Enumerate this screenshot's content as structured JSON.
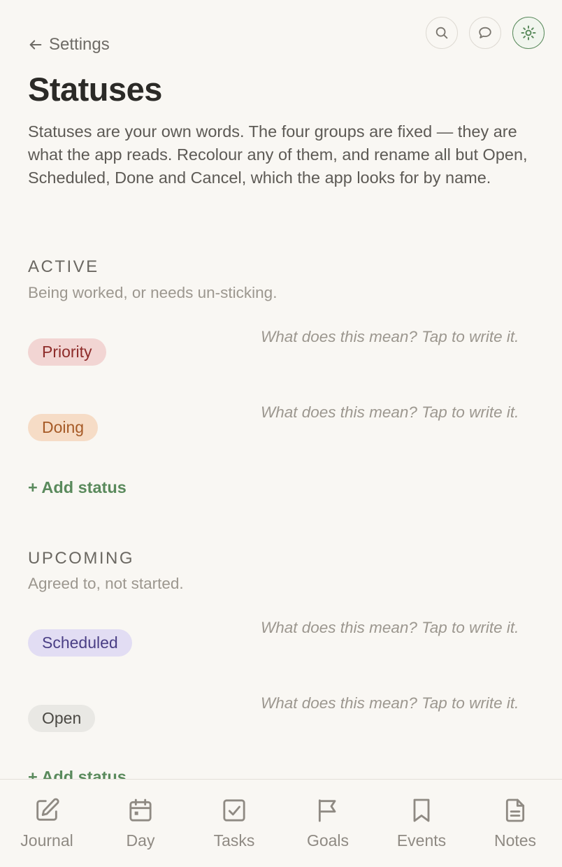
{
  "header": {
    "back_label": "Settings",
    "title": "Statuses",
    "intro": "Statuses are your own words. The four groups are fixed — they are what the app reads. Recolour any of them, and rename all but Open, Scheduled, Done and Cancel, which the app looks for by name."
  },
  "top_icons": [
    {
      "name": "search-icon"
    },
    {
      "name": "chat-bubble-icon"
    },
    {
      "name": "sun-icon",
      "active": true
    }
  ],
  "colors": {
    "accent_green": "#5a8a5c",
    "priority_bg": "#f2d5d3",
    "priority_fg": "#8e2c2a",
    "doing_bg": "#f6dcc6",
    "doing_fg": "#a65a26",
    "scheduled_bg": "#e2ddf3",
    "scheduled_fg": "#4a3f85",
    "open_bg": "#e9e8e4",
    "open_fg": "#4b4944"
  },
  "groups": {
    "active": {
      "title": "ACTIVE",
      "subtitle": "Being worked, or needs un-sticking.",
      "statuses": [
        {
          "label": "Priority",
          "description": "What does this mean? Tap to write it."
        },
        {
          "label": "Doing",
          "description": "What does this mean? Tap to write it."
        }
      ],
      "add_label": "+ Add status"
    },
    "upcoming": {
      "title": "UPCOMING",
      "subtitle": "Agreed to, not started.",
      "statuses": [
        {
          "label": "Scheduled",
          "description": "What does this mean? Tap to write it."
        },
        {
          "label": "Open",
          "description": "What does this mean? Tap to write it."
        }
      ],
      "add_label": "+ Add status"
    }
  },
  "tabbar": {
    "items": [
      {
        "label": "Journal",
        "icon": "pencil-square-icon"
      },
      {
        "label": "Day",
        "icon": "calendar-icon"
      },
      {
        "label": "Tasks",
        "icon": "checkbox-icon"
      },
      {
        "label": "Goals",
        "icon": "flag-icon"
      },
      {
        "label": "Events",
        "icon": "bookmark-icon"
      },
      {
        "label": "Notes",
        "icon": "document-icon"
      }
    ]
  }
}
